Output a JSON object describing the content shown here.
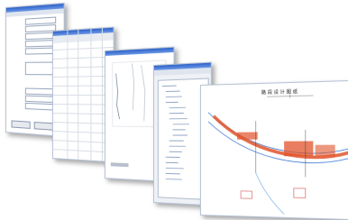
{
  "windows": [
    {
      "id": "form",
      "title": "",
      "fields": [
        "",
        "",
        "",
        "",
        "",
        ""
      ],
      "buttons": [
        "",
        ""
      ]
    },
    {
      "id": "table",
      "title": ""
    },
    {
      "id": "profile",
      "title": ""
    },
    {
      "id": "tree",
      "title": ""
    },
    {
      "id": "map",
      "title": "路 段 设 计 图 纸"
    }
  ],
  "colors": {
    "titlebar": "#2d62c8",
    "map_highlight": "#e0532a",
    "road_blue": "#2f6fd0"
  }
}
